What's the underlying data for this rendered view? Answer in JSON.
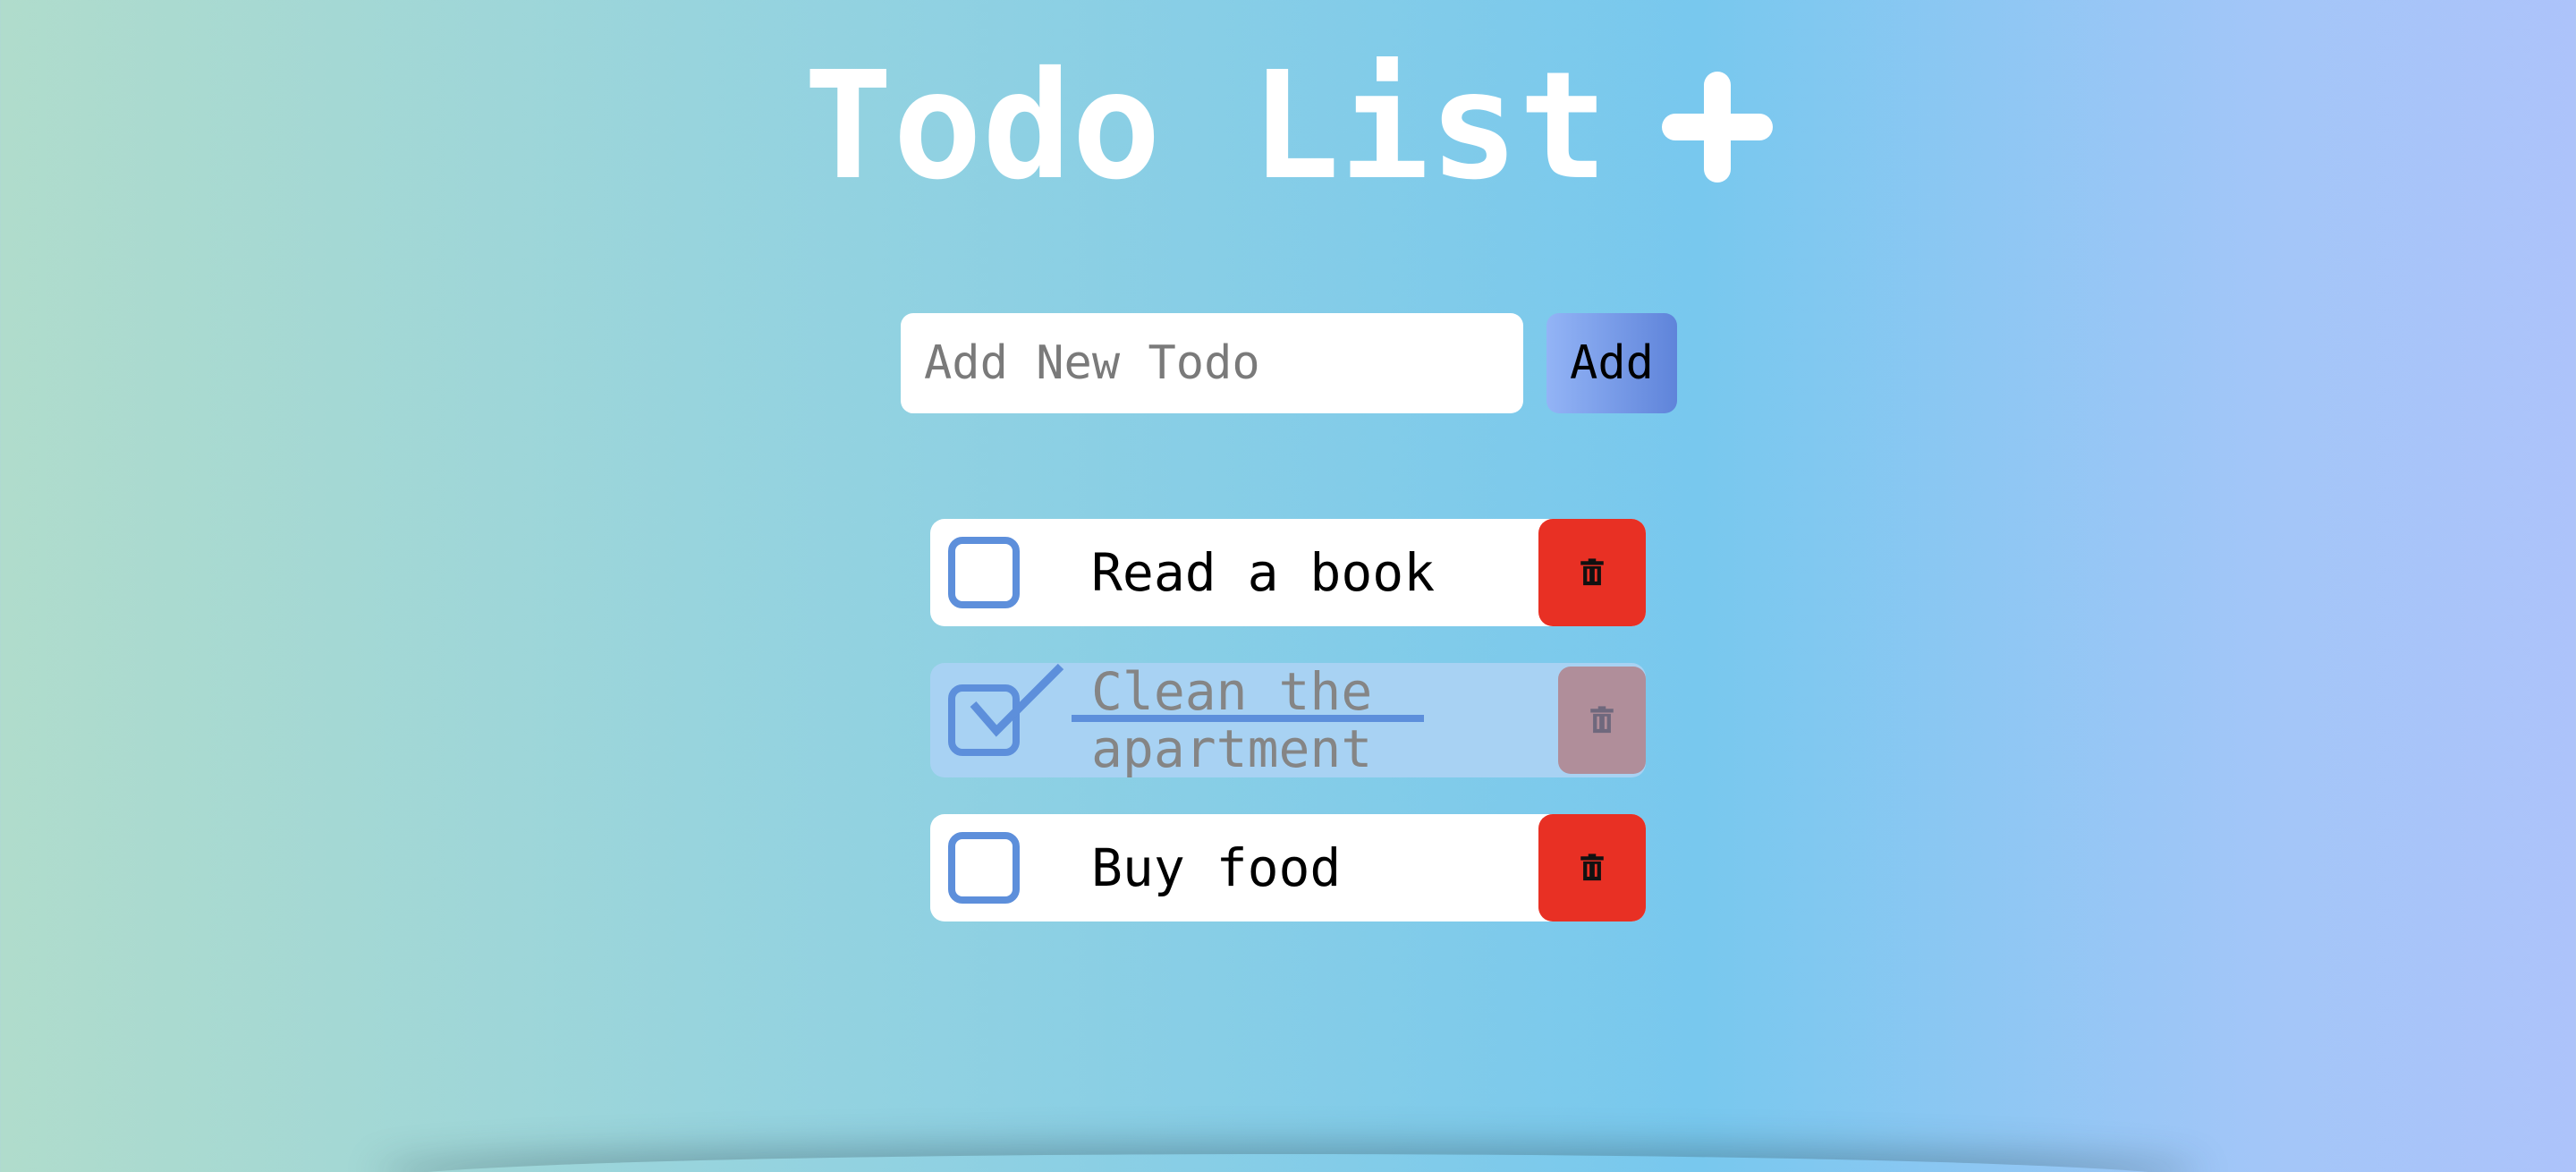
{
  "header": {
    "title": "Todo List",
    "title_icon": "plus-icon"
  },
  "new_todo": {
    "placeholder": "Add New Todo",
    "value": "",
    "add_label": "Add"
  },
  "todos": [
    {
      "text": "Read a book",
      "completed": false,
      "delete_icon": "trash-icon"
    },
    {
      "text": "Clean the apartment",
      "completed": true,
      "delete_icon": "trash-icon"
    },
    {
      "text": "Buy food",
      "completed": false,
      "delete_icon": "trash-icon"
    }
  ],
  "colors": {
    "accent": "#5d8fdb",
    "delete": "#e83024",
    "delete_disabled": "#b08e9a",
    "completed_row": "#a8d2f3"
  }
}
